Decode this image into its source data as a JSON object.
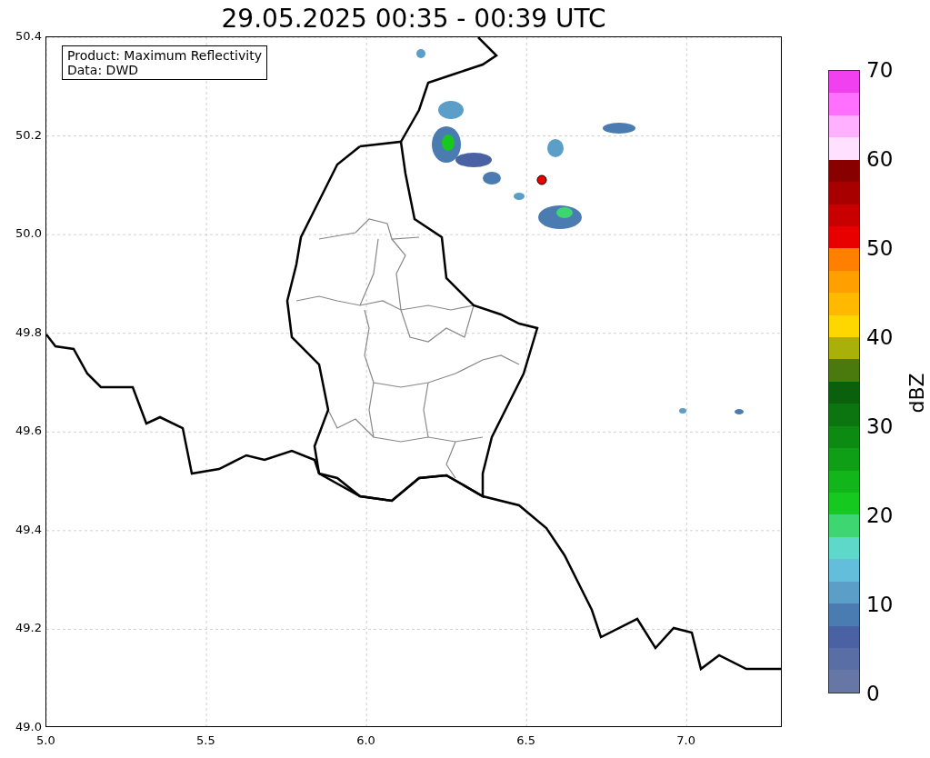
{
  "title": "29.05.2025 00:35 - 00:39 UTC",
  "legend": {
    "lines": [
      "Product: Maximum Reflectivity",
      "Data: DWD"
    ]
  },
  "x_axis": {
    "ticks": [
      "5.0",
      "5.5",
      "6.0",
      "6.5",
      "7.0"
    ]
  },
  "y_axis": {
    "ticks": [
      "50.4",
      "50.2",
      "50.0",
      "49.8",
      "49.6",
      "49.4",
      "49.2",
      "49.0"
    ]
  },
  "colorbar": {
    "unit": "dBZ",
    "labels": [
      "70",
      "60",
      "50",
      "40",
      "30",
      "20",
      "10",
      "0"
    ],
    "segments": [
      {
        "color": "#f040f0"
      },
      {
        "color": "#ff70ff"
      },
      {
        "color": "#ffb0ff"
      },
      {
        "color": "#ffe0ff"
      },
      {
        "color": "#880000"
      },
      {
        "color": "#a80000"
      },
      {
        "color": "#c80000"
      },
      {
        "color": "#e80000"
      },
      {
        "color": "#ff7f00"
      },
      {
        "color": "#ffa000"
      },
      {
        "color": "#ffba00"
      },
      {
        "color": "#ffd700"
      },
      {
        "color": "#aab00a"
      },
      {
        "color": "#4a7a0e"
      },
      {
        "color": "#0a600d"
      },
      {
        "color": "#0c7510"
      },
      {
        "color": "#0d8a12"
      },
      {
        "color": "#0f9f16"
      },
      {
        "color": "#12b51a"
      },
      {
        "color": "#16c91e"
      },
      {
        "color": "#3ed670"
      },
      {
        "color": "#5ed8c8"
      },
      {
        "color": "#62bedb"
      },
      {
        "color": "#5b9ec8"
      },
      {
        "color": "#4a7bb1"
      },
      {
        "color": "#4a62a3"
      },
      {
        "color": "#5a6ea6"
      },
      {
        "color": "#6677a6"
      }
    ]
  }
}
